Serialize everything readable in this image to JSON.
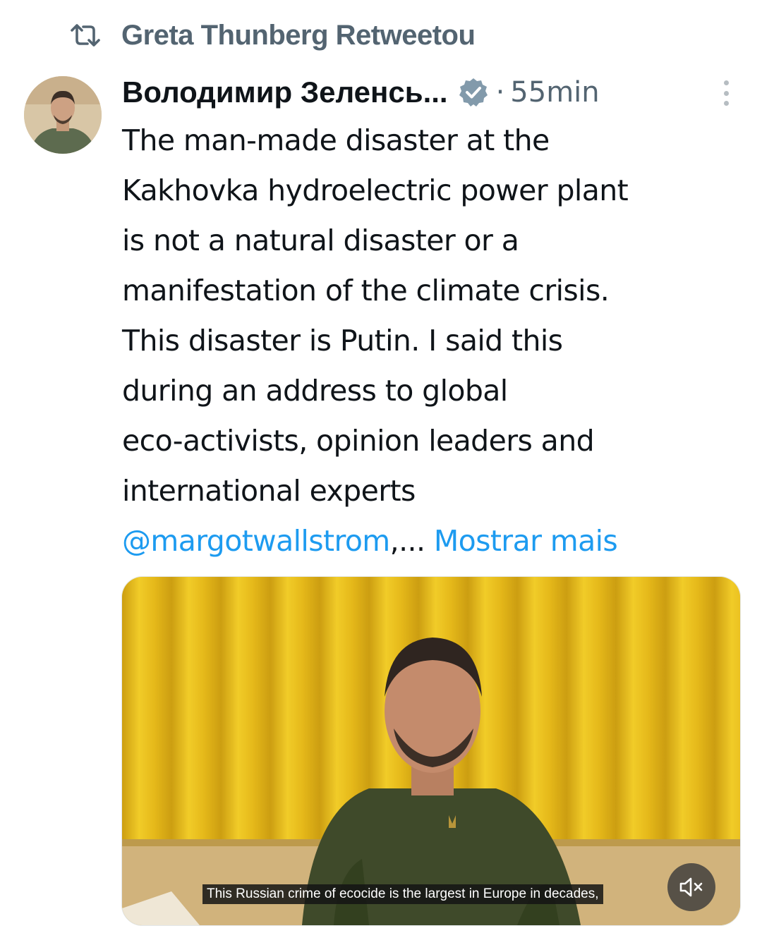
{
  "retweet": {
    "icon": "retweet-icon",
    "label": "Greta Thunberg Retweetou"
  },
  "tweet": {
    "author": "Володимир Зеленсь...",
    "verified_icon": "verified-badge-icon",
    "dot": "·",
    "time": "55min",
    "lines": [
      "The man-made disaster at the",
      "Kakhovka hydroelectric power plant",
      "is not a natural disaster or a",
      "manifestation of the climate crisis.",
      "This disaster is Putin. I said this",
      "during an address to global",
      "eco-activists, opinion leaders and",
      "international experts"
    ],
    "mention": "@margotwallstrom",
    "ellipsis": ",... ",
    "show_more": "Mostrar mais"
  },
  "media": {
    "caption": "This Russian crime of ecocide is the largest in Europe in decades,",
    "mute_icon": "speaker-muted-icon"
  },
  "colors": {
    "link": "#1d9bf0",
    "secondary_text": "#536471",
    "primary_text": "#0f1419",
    "verified": "#829aab",
    "flag_yellow": "#e8c019"
  }
}
